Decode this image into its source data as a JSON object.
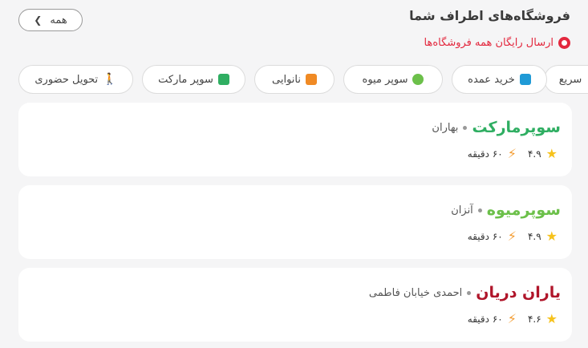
{
  "header": {
    "title": "فروشگاه‌های اطراف شما",
    "subtitle": "ارسال رایگان همه فروشگاه‌ها",
    "all_label": "همه"
  },
  "chips": [
    {
      "label": "سریع",
      "icon": "bolt-icon",
      "color": "#6c5ce7"
    },
    {
      "label": "خرید عمده",
      "icon": "box-icon",
      "color": "#1f9ad6"
    },
    {
      "label": "سوپر میوه",
      "icon": "apple-icon",
      "color": "#6cc04a"
    },
    {
      "label": "نانوایی",
      "icon": "bread-icon",
      "color": "#f08a24"
    },
    {
      "label": "سوپر مارکت",
      "icon": "store-icon",
      "color": "#2fae62"
    },
    {
      "label": "تحویل حضوری",
      "icon": "walking-icon",
      "color": "#222222"
    }
  ],
  "stores": [
    {
      "name": "سوپرمارکت",
      "name_color": "#2fae62",
      "area": "بهاران",
      "rating": "۴.۹",
      "time": "۶۰ دقیقه"
    },
    {
      "name": "سوپرمیوه",
      "name_color": "#6cc04a",
      "area": "آنزان",
      "rating": "۴.۹",
      "time": "۶۰ دقیقه"
    },
    {
      "name": "یاران دریان",
      "name_color": "#b0152a",
      "area": "احمدی خیابان فاطمی",
      "rating": "۴.۶",
      "time": "۶۰ دقیقه"
    }
  ]
}
